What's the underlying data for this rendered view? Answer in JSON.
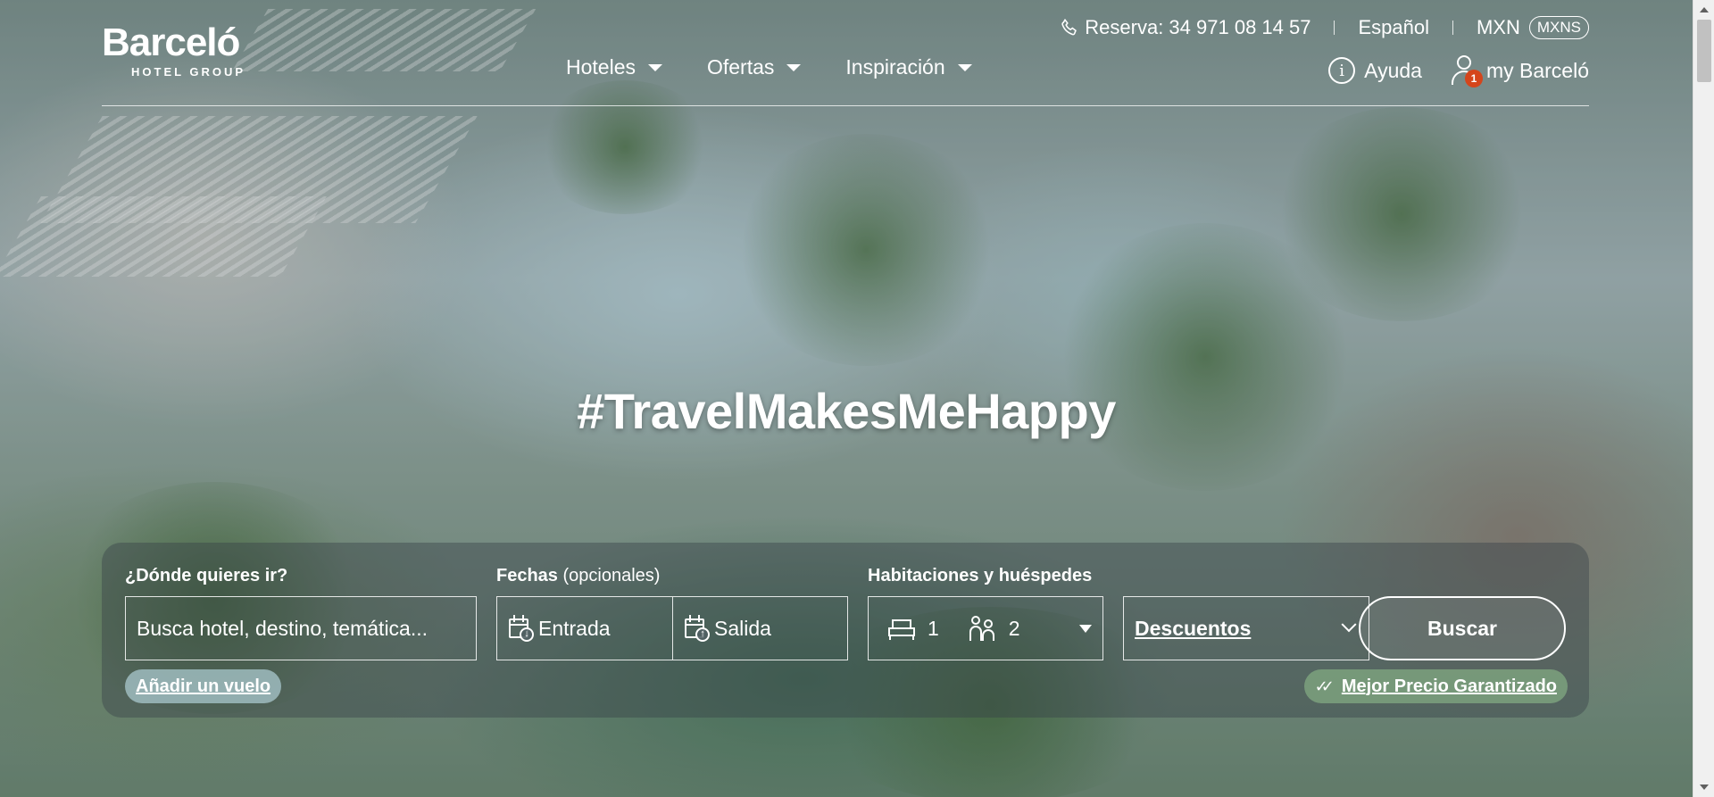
{
  "header": {
    "logo_brand": "Barceló",
    "logo_group": "HOTEL GROUP",
    "reservation_label": "Reserva: 34 971 08 14 57",
    "language": "Español",
    "currency": "MXN",
    "currency_badge": "MXNS",
    "nav": [
      {
        "label": "Hoteles"
      },
      {
        "label": "Ofertas"
      },
      {
        "label": "Inspiración"
      }
    ],
    "help_label": "Ayuda",
    "account_label": "my Barceló",
    "notification_count": "1",
    "info_glyph": "i"
  },
  "hero": {
    "title": "#TravelMakesMeHappy"
  },
  "search": {
    "destination_label": "¿Dónde quieres ir?",
    "destination_placeholder": "Busca hotel, destino, temática...",
    "dates_label": "Fechas",
    "dates_optional": "(opcionales)",
    "checkin_label": "Entrada",
    "checkout_label": "Salida",
    "rooms_label": "Habitaciones y huéspedes",
    "rooms_count": "1",
    "guests_count": "2",
    "discount_label": "Descuentos",
    "search_button": "Buscar",
    "add_flight": "Añadir un vuelo",
    "best_price": "Mejor Precio Garantizado"
  },
  "icons": {
    "phone": "phone-icon",
    "info": "info-icon",
    "user": "user-icon",
    "calendar_in": "calendar-checkin-icon",
    "calendar_out": "calendar-checkout-icon",
    "bed": "bed-icon",
    "people": "people-icon",
    "check": "double-check-icon"
  },
  "colors": {
    "notification_badge": "#d5451b",
    "text": "#ffffff"
  }
}
